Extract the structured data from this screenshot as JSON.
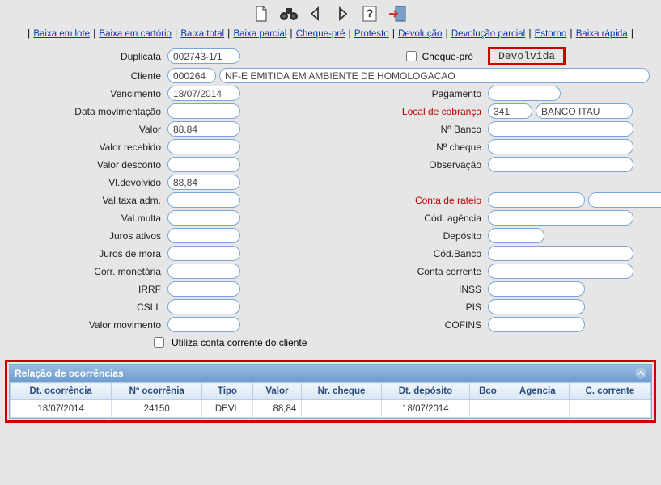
{
  "links": {
    "baixa_lote": "Baixa em lote",
    "baixa_cartorio": "Baixa em cartório",
    "baixa_total": "Baixa total",
    "baixa_parcial": "Baixa parcial",
    "cheque_pre": "Cheque-pré",
    "protesto": "Protesto",
    "devolucao": "Devolução",
    "devolucao_parcial": "Devolução parcial",
    "estorno": "Estorno",
    "baixa_rapida": "Baixa rápida"
  },
  "labels": {
    "duplicata": "Duplicata",
    "cheque_pre_chk": "Cheque-pré",
    "cliente": "Cliente",
    "vencimento": "Vencimento",
    "pagamento": "Pagamento",
    "data_mov": "Data movimentação",
    "local_cob": "Local de cobrança",
    "valor": "Valor",
    "n_banco": "Nº Banco",
    "valor_recebido": "Valor recebido",
    "n_cheque": "Nº cheque",
    "valor_desconto": "Valor desconto",
    "observacao": "Observação",
    "vl_devolvido": "Vl.devolvido",
    "val_taxa_adm": "Val.taxa adm.",
    "conta_rateio": "Conta de rateio",
    "val_multa": "Val.multa",
    "cod_agencia": "Cód. agência",
    "juros_ativos": "Juros ativos",
    "deposito": "Depósito",
    "juros_mora": "Juros de mora",
    "cod_banco": "Cód.Banco",
    "corr_monet": "Corr. monetária",
    "conta_corrente": "Conta corrente",
    "irrf": "IRRF",
    "inss": "INSS",
    "csll": "CSLL",
    "pis": "PIS",
    "valor_mov": "Valor movimento",
    "cofins": "COFINS",
    "utiliza_cc": "Utiliza conta corrente do cliente"
  },
  "status": "Devolvida",
  "v": {
    "duplicata": "002743-1/1",
    "cliente_cod": "000264",
    "cliente_nome": "NF-E EMITIDA EM AMBIENTE DE HOMOLOGACAO",
    "vencimento": "18/07/2014",
    "pagamento": "",
    "data_mov": "",
    "local_cob_cod": "341",
    "local_cob_nome": "BANCO ITAU",
    "valor": "88,84",
    "n_banco": "",
    "valor_recebido": "",
    "n_cheque": "",
    "valor_desconto": "",
    "observacao": "",
    "vl_devolvido": "88,84",
    "val_taxa_adm": "",
    "conta_rateio1": "",
    "conta_rateio2": "",
    "val_multa": "",
    "cod_agencia": "",
    "juros_ativos": "",
    "deposito": "",
    "juros_mora": "",
    "cod_banco": "",
    "corr_monet": "",
    "conta_corrente": "",
    "irrf": "",
    "inss": "",
    "csll": "",
    "pis": "",
    "valor_mov": "",
    "cofins": ""
  },
  "panel": {
    "title": "Relação de ocorrências",
    "headers": [
      "Dt. ocorrência",
      "Nº ocorrênia",
      "Tipo",
      "Valor",
      "Nr. cheque",
      "Dt. depósito",
      "Bco",
      "Agencia",
      "C. corrente"
    ],
    "row": [
      "18/07/2014",
      "24150",
      "DEVL",
      "88,84",
      "",
      "18/07/2014",
      "",
      "",
      ""
    ]
  }
}
